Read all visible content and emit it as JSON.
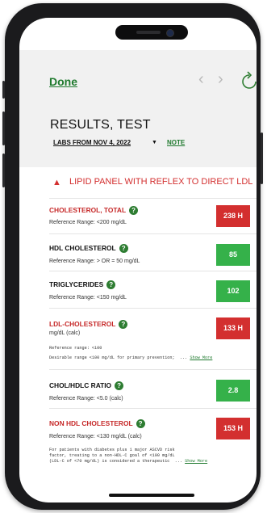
{
  "header": {
    "done_label": "Done",
    "prev_icon": "‹",
    "next_icon": "›",
    "title": "RESULTS, TEST",
    "labs_label": "LABS FROM NOV 4, 2022",
    "labs_caret": "▼",
    "note_label": "NOTE"
  },
  "panel": {
    "warn_icon": "▲",
    "title": "LIPID PANEL WITH REFLEX TO DIRECT LDL"
  },
  "results": [
    {
      "name": "CHOLESTEROL, TOTAL",
      "range": "Reference Range: <200  mg/dL",
      "value": "238 H"
    },
    {
      "name": "HDL CHOLESTEROL",
      "range": "Reference Range: > OR = 50  mg/dL",
      "value": "85"
    },
    {
      "name": "TRIGLYCERIDES",
      "range": "Reference Range: <150  mg/dL",
      "value": "102"
    },
    {
      "name": "LDL-CHOLESTEROL",
      "range": "mg/dL (calc)",
      "value": "133 H",
      "note_line1": "Reference range: <100",
      "note_line2": "Desirable range <100 mg/dL for primary prevention;  ... ",
      "show_more": "Show More"
    },
    {
      "name": "CHOL/HDLC RATIO",
      "range": "Reference Range: <5.0  (calc)",
      "value": "2.8"
    },
    {
      "name": "NON HDL CHOLESTEROL",
      "range": "Reference Range: <130  mg/dL (calc)",
      "value": "153 H",
      "note_line1": "For patients with diabetes plus 1 major ASCVD risk",
      "note_line2": "factor, treating to a non-HDL-C goal of <100 mg/dL",
      "note_line3": "(LDL-C of <70 mg/dL) is considered a therapeutic  ... ",
      "show_more": "Show More"
    }
  ],
  "help_icon": "?",
  "colors": {
    "high": "#d32f2f",
    "normal": "#35b14a",
    "accent": "#1f7a2e"
  }
}
